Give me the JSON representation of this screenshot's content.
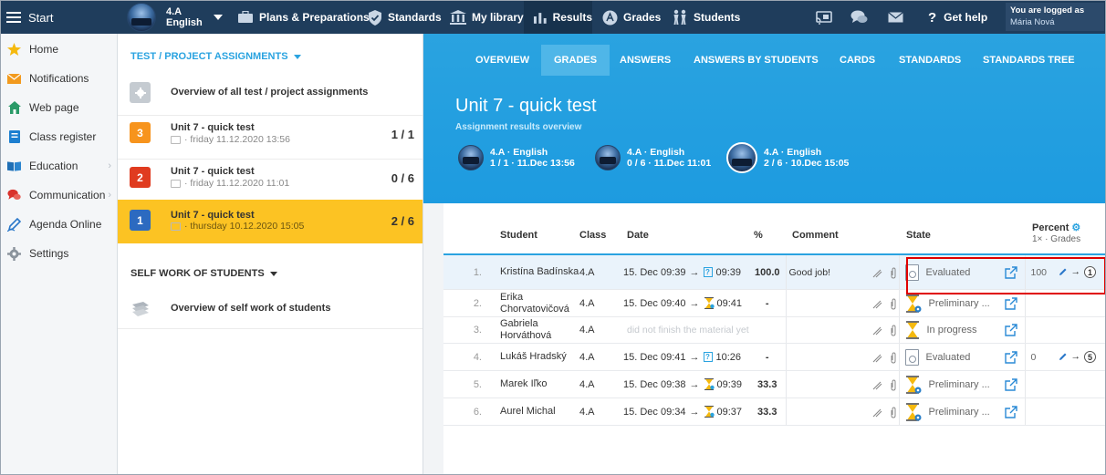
{
  "topbar": {
    "start_label": "Start",
    "class_selector": {
      "class": "4.A",
      "subject": "English"
    },
    "nav": [
      {
        "label": "Plans & Preparations",
        "icon": "briefcase-icon"
      },
      {
        "label": "Standards",
        "icon": "shield-check-icon"
      },
      {
        "label": "My library",
        "icon": "library-icon"
      },
      {
        "label": "Results",
        "icon": "bar-chart-icon"
      },
      {
        "label": "Grades",
        "icon": "grades-icon"
      },
      {
        "label": "Students",
        "icon": "students-icon"
      }
    ],
    "active_nav": "Results",
    "help_label": "Get help",
    "help_icon": "question-icon",
    "logged_label": "You are logged as",
    "user_name": "Mária Nová"
  },
  "sidebar": {
    "items": [
      {
        "label": "Home",
        "icon": "star-icon"
      },
      {
        "label": "Notifications",
        "icon": "envelope-icon"
      },
      {
        "label": "Web page",
        "icon": "house-icon"
      },
      {
        "label": "Class register",
        "icon": "register-icon"
      },
      {
        "label": "Education",
        "icon": "book-icon",
        "has_submenu": true
      },
      {
        "label": "Communication",
        "icon": "chat-icon",
        "has_submenu": true
      },
      {
        "label": "Agenda Online",
        "icon": "pen-icon"
      },
      {
        "label": "Settings",
        "icon": "gear-icon"
      }
    ]
  },
  "assignments": {
    "section_title": "TEST / PROJECT ASSIGNMENTS",
    "overview_label": "Overview of all test / project assignments",
    "items": [
      {
        "number": "3",
        "title": "Unit 7 - quick test",
        "date": "· friday 11.12.2020 13:56",
        "ratio": "1 / 1",
        "color": "#f7941d"
      },
      {
        "number": "2",
        "title": "Unit 7 - quick test",
        "date": "· friday 11.12.2020 11:01",
        "ratio": "0 / 6",
        "color": "#e03b1f"
      },
      {
        "number": "1",
        "title": "Unit 7 - quick test",
        "date": "· thursday 10.12.2020 15:05",
        "ratio": "2 / 6",
        "color": "#2c6ac0"
      }
    ],
    "selected_index": 2,
    "self_work_title": "SELF WORK OF STUDENTS",
    "self_work_overview": "Overview of self work of students"
  },
  "main": {
    "tabs": [
      "OVERVIEW",
      "GRADES",
      "ANSWERS",
      "ANSWERS BY STUDENTS",
      "CARDS",
      "STANDARDS",
      "STANDARDS TREE"
    ],
    "active_tab": "GRADES",
    "title": "Unit 7 - quick test",
    "subtitle": "Assignment results overview",
    "versions": [
      {
        "line1": "4.A · English",
        "line2": "1 / 1 · 11.Dec 13:56"
      },
      {
        "line1": "4.A · English",
        "line2": "0 / 6 · 11.Dec 11:01"
      },
      {
        "line1": "4.A · English",
        "line2": "2 / 6 · 10.Dec 15:05"
      }
    ],
    "columns": {
      "student": "Student",
      "class": "Class",
      "date": "Date",
      "percent": "%",
      "comment": "Comment",
      "state": "State",
      "percent_grade": "Percent",
      "percent_grade_sub": "1× · Grades"
    },
    "rows": [
      {
        "index": "1.",
        "name": "Kristína Badínska",
        "class": "4.A",
        "start": "15. Dec 09:39",
        "end": "09:39",
        "end_icon": "question-icon",
        "percent": "100.0",
        "comment": "Good job!",
        "state": "Evaluated",
        "state_icon": "document-icon",
        "score": "100",
        "grade": "1"
      },
      {
        "index": "2.",
        "name": "Erika Chorvatovičová",
        "class": "4.A",
        "start": "15. Dec 09:40",
        "end": "09:41",
        "end_icon": "hourglass-icon",
        "percent": "-",
        "comment": "",
        "state": "Preliminary ...",
        "state_icon": "hourglass-gear-icon",
        "score": "",
        "grade": ""
      },
      {
        "index": "3.",
        "name": "Gabriela Horváthová",
        "class": "4.A",
        "start": "",
        "end": "",
        "end_icon": "",
        "percent": "",
        "note": "did not finish the material yet",
        "comment": "",
        "state": "In progress",
        "state_icon": "hourglass-icon",
        "score": "",
        "grade": ""
      },
      {
        "index": "4.",
        "name": "Lukáš Hradský",
        "class": "4.A",
        "start": "15. Dec 09:41",
        "end": "10:26",
        "end_icon": "question-icon",
        "percent": "-",
        "comment": "",
        "state": "Evaluated",
        "state_icon": "document-icon",
        "score": "0",
        "grade": "5"
      },
      {
        "index": "5.",
        "name": "Marek Iľko",
        "class": "4.A",
        "start": "15. Dec 09:38",
        "end": "09:39",
        "end_icon": "hourglass-icon",
        "percent": "33.3",
        "comment": "",
        "state": "Preliminary ...",
        "state_icon": "hourglass-gear-icon",
        "score": "",
        "grade": ""
      },
      {
        "index": "6.",
        "name": "Aurel Michal",
        "class": "4.A",
        "start": "15. Dec 09:34",
        "end": "09:37",
        "end_icon": "hourglass-icon",
        "percent": "33.3",
        "comment": "",
        "state": "Preliminary ...",
        "state_icon": "hourglass-gear-icon",
        "score": "",
        "grade": ""
      }
    ]
  },
  "colors": {
    "accent": "#2aa3e0",
    "topbar": "#1f3d5c",
    "selected": "#fcc323",
    "highlight": "#e00000"
  }
}
